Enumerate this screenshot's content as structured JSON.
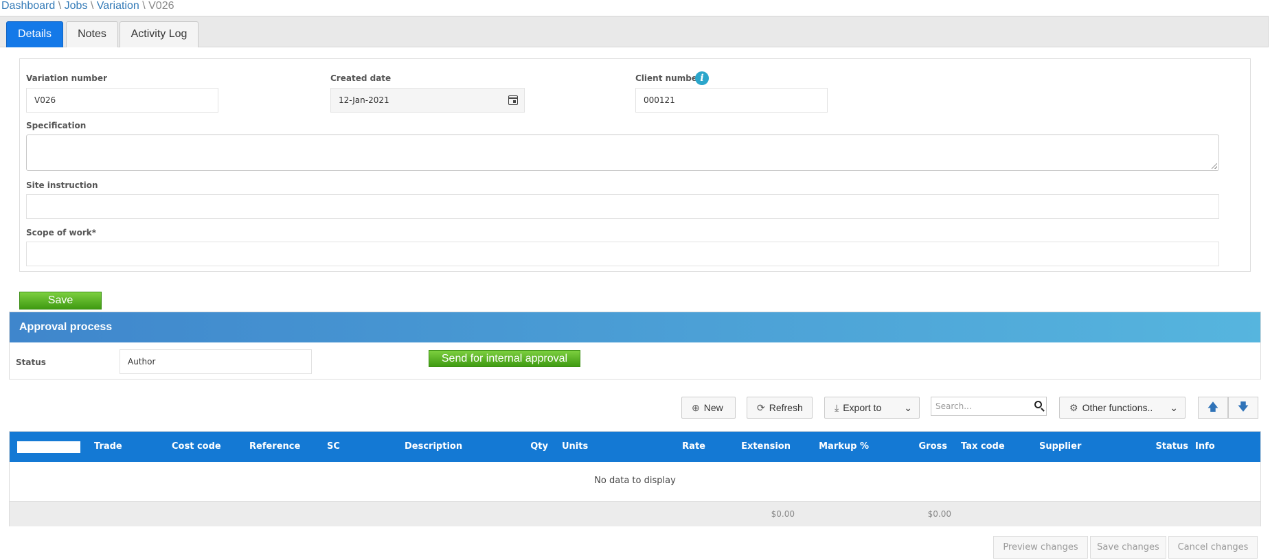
{
  "breadcrumb": {
    "items": [
      "Dashboard",
      "Jobs",
      "Variation"
    ],
    "separator": "\\",
    "current": "V026"
  },
  "tabs": [
    {
      "label": "Details",
      "active": true
    },
    {
      "label": "Notes",
      "active": false
    },
    {
      "label": "Activity Log",
      "active": false
    }
  ],
  "form": {
    "variation_number": {
      "label": "Variation number",
      "value": "V026"
    },
    "created_date": {
      "label": "Created date",
      "value": "12-Jan-2021",
      "icon": "calendar-icon"
    },
    "client_number": {
      "label": "Client number",
      "value": "000121",
      "info_glyph": "i"
    },
    "specification": {
      "label": "Specification",
      "value": ""
    },
    "site_instruction": {
      "label": "Site instruction",
      "value": ""
    },
    "scope_of_work": {
      "label": "Scope of work*",
      "value": ""
    }
  },
  "save_label": "Save",
  "approval": {
    "title": "Approval process",
    "status_label": "Status",
    "status_value": "Author",
    "send_label": "Send for internal approval"
  },
  "toolbar": {
    "new_label": "New",
    "refresh_label": "Refresh",
    "export_label": "Export to",
    "search_placeholder": "Search...",
    "other_label": "Other functions..",
    "up_glyph": "🡅",
    "down_glyph": "🡇"
  },
  "grid": {
    "columns": [
      "Trade",
      "Cost code",
      "Reference",
      "SC",
      "Description",
      "Qty",
      "Units",
      "Rate",
      "Extension",
      "Markup %",
      "Gross",
      "Tax code",
      "Supplier",
      "Status",
      "Info"
    ],
    "empty_text": "No data to display",
    "totals": {
      "extension": "$0.00",
      "gross": "$0.00"
    }
  },
  "footer": {
    "preview_label": "Preview changes",
    "save_changes_label": "Save changes",
    "cancel_label": "Cancel changes"
  },
  "colors": {
    "primary": "#1479e8",
    "grid_header": "#1479d4",
    "success": "#4caf1f",
    "link": "#337ab7"
  }
}
